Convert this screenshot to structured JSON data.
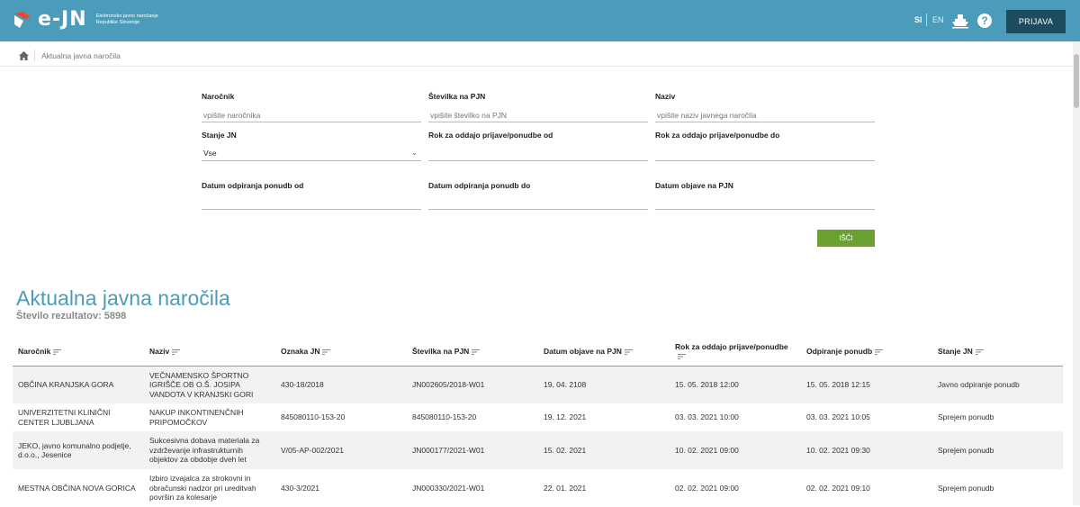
{
  "header": {
    "brand": "e-JN",
    "brand_sub": "Elektronsko javno naročanje Republike Slovenije",
    "lang_si": "SI",
    "lang_en": "EN",
    "help": "?",
    "login": "PRIJAVA"
  },
  "breadcrumb": {
    "current": "Aktualna javna naročila"
  },
  "form": {
    "narocnik_label": "Naročnik",
    "narocnik_placeholder": "vpišite naročnika",
    "stevilka_label": "Številka na PJN",
    "stevilka_placeholder": "vpišite številko na PJN",
    "naziv_label": "Naziv",
    "naziv_placeholder": "vpišite naziv javnega naročila",
    "stanje_label": "Stanje JN",
    "stanje_value": "Vse",
    "rok_od_label": "Rok za oddajo prijave/ponudbe od",
    "rok_do_label": "Rok za oddajo prijave/ponudbe do",
    "odp_od_label": "Datum odpiranja ponudb od",
    "odp_do_label": "Datum odpiranja ponudb do",
    "objava_label": "Datum objave na PJN",
    "search": "IŠČI"
  },
  "results": {
    "title": "Aktualna javna naročila",
    "count": "Število rezultatov: 5898"
  },
  "table": {
    "headers": [
      "Naročnik",
      "Naziv",
      "Oznaka JN",
      "Številka na PJN",
      "Datum objave na PJN",
      "Rok za oddajo prijave/ponudbe",
      "Odpiranje ponudb",
      "Stanje JN"
    ],
    "rows": [
      [
        "OBČINA KRANJSKA GORA",
        "VEČNAMENSKO ŠPORTNO IGRIŠČE OB O.Š. JOSIPA VANDOTA V KRANJSKI GORI",
        "430-18/2018",
        "JN002605/2018-W01",
        "19. 04. 2108",
        "15. 05. 2018 12:00",
        "15. 05. 2018 12:15",
        "Javno odpiranje ponudb"
      ],
      [
        "UNIVERZITETNI KLINIČNI CENTER LJUBLJANA",
        "NAKUP INKONTINENČNIH PRIPOMOČKOV",
        "845080110-153-20",
        "845080110-153-20",
        "19. 12. 2021",
        "03. 03. 2021 10:00",
        "03. 03. 2021 10:05",
        "Sprejem ponudb"
      ],
      [
        "JEKO, javno komunalno podjetje, d.o.o., Jesenice",
        "Sukcesivna dobava materiala za vzdrževanje infrastrukturnih objektov za obdobje dveh let",
        "V/05-AP-002/2021",
        "JN000177/2021-W01",
        "15. 02. 2021",
        "10. 02. 2021 09:00",
        "10. 02. 2021 09:30",
        "Sprejem ponudb"
      ],
      [
        "MESTNA OBČINA NOVA GORICA",
        "Izbiro izvajalca za strokovni in obračunski nadzor pri ureditvah površin za kolesarje",
        "430-3/2021",
        "JN000330/2021-W01",
        "22. 01. 2021",
        "02. 02. 2021 09:00",
        "02. 02. 2021 09:10",
        "Sprejem ponudb"
      ]
    ]
  },
  "colors": {
    "header_bg": "#4a9cba",
    "login_bg": "#1d4c61",
    "search_bg": "#6a9f32",
    "title": "#4a9cba"
  }
}
